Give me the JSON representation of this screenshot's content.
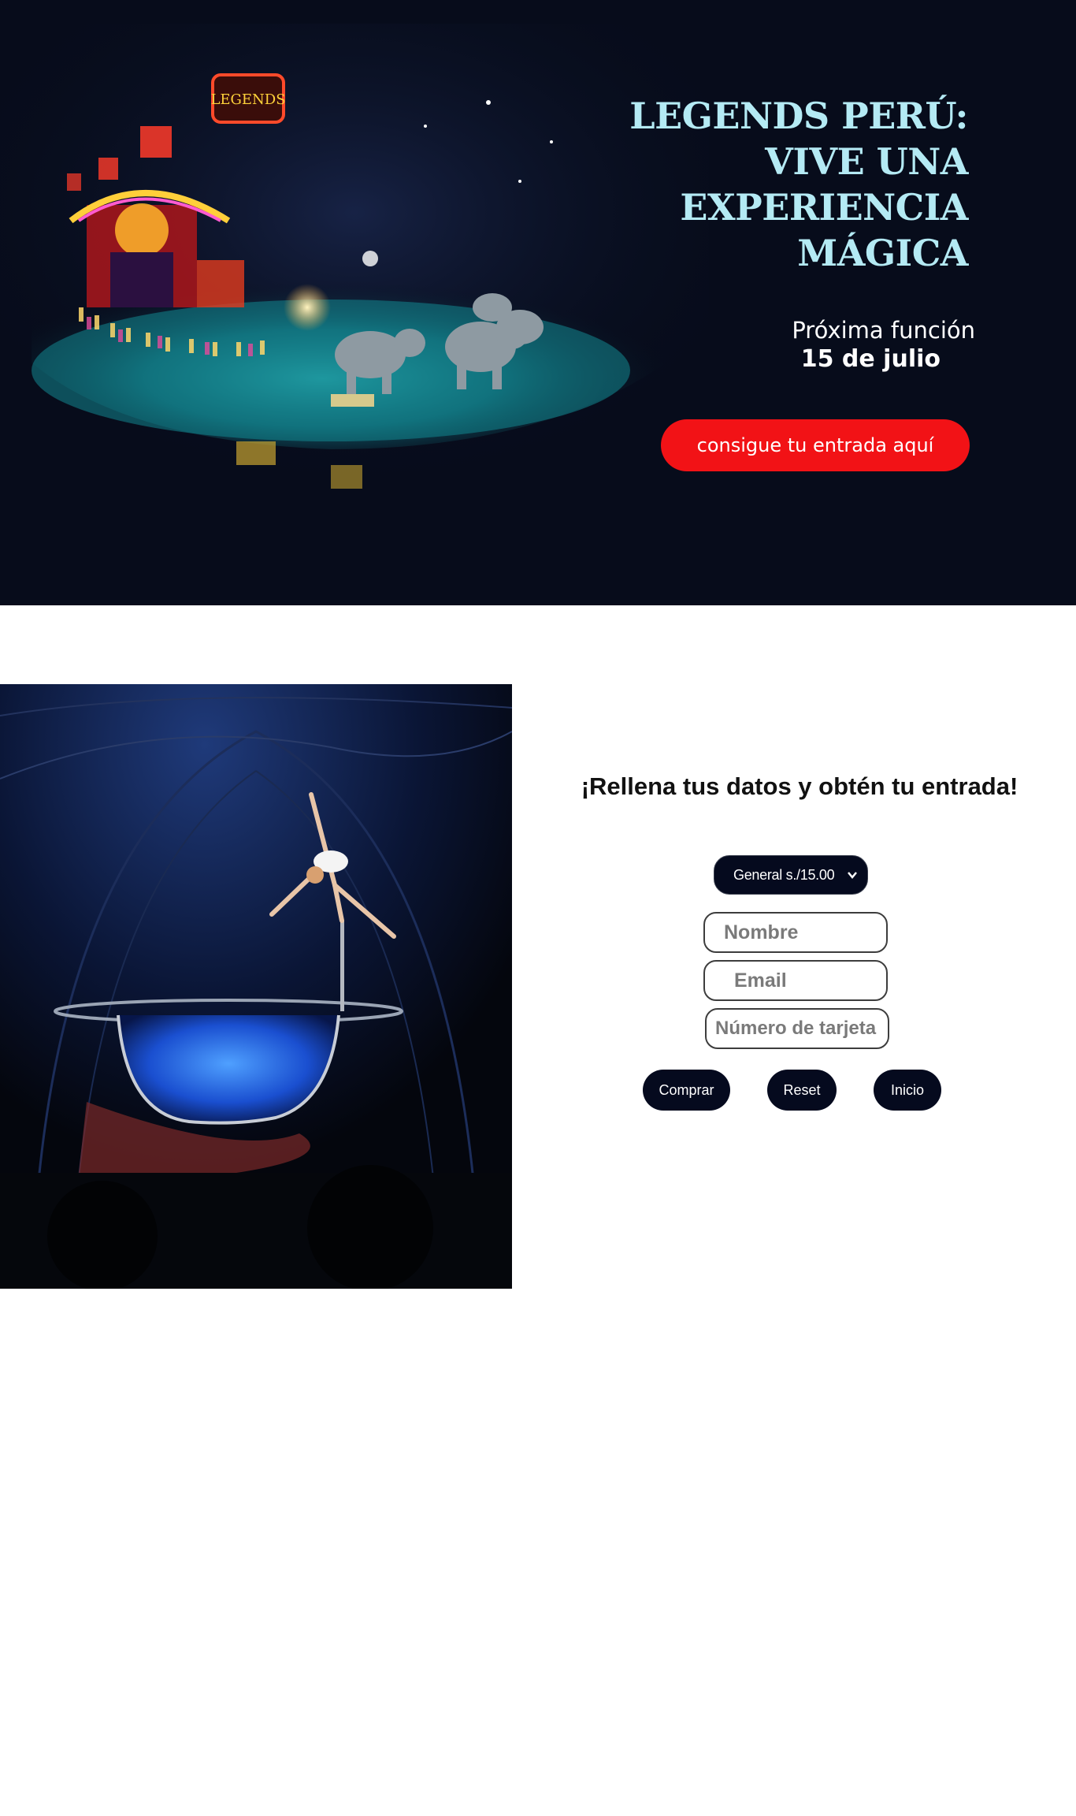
{
  "hero": {
    "title_lines": [
      "LEGENDS PERÚ:",
      "VIVE UNA",
      "EXPERIENCIA",
      "MÁGICA"
    ],
    "next_show_label": "Próxima función",
    "next_show_date": "15 de julio",
    "cta_label": "consigue tu entrada aquí",
    "image": "circus-arena-photo",
    "arena_sign": "LEGENDS"
  },
  "form": {
    "title": "¡Rellena tus datos y obtén tu entrada!",
    "ticket_select": {
      "selected": "General s./15.00"
    },
    "fields": {
      "name_placeholder": "Nombre",
      "email_placeholder": "Email",
      "card_placeholder": "Número de tarjeta"
    },
    "buttons": {
      "buy": "Comprar",
      "reset": "Reset",
      "home": "Inicio"
    }
  },
  "colors": {
    "hero_background": "#070c1b",
    "title": "#b4eaf4",
    "cta": "#f21216",
    "button_dark": "#050a1e"
  }
}
